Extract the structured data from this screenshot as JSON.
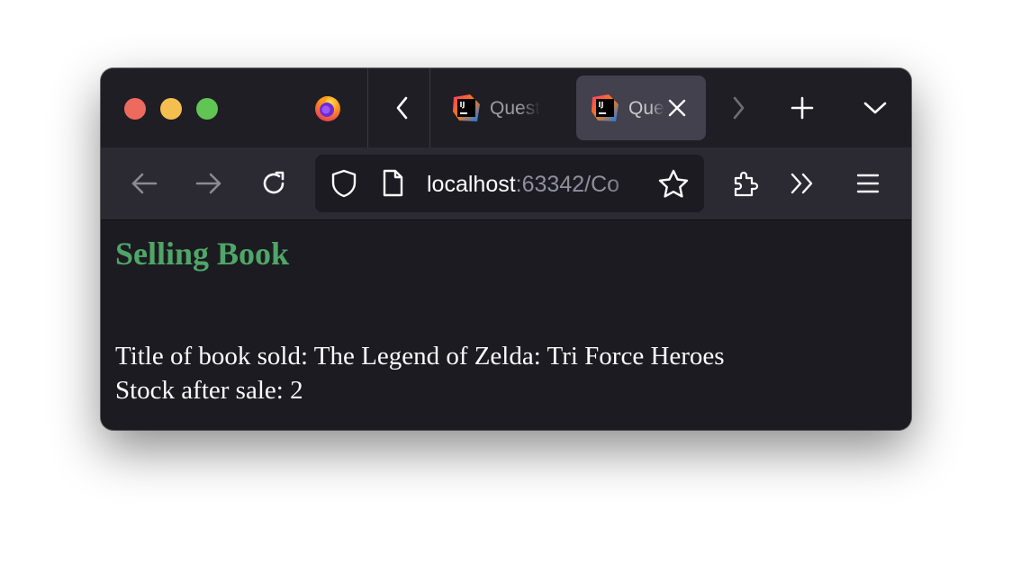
{
  "browser": {
    "tabs": [
      {
        "label": "Questi",
        "active": false,
        "favicon": "intellij-icon"
      },
      {
        "label": "Que",
        "active": true,
        "favicon": "intellij-icon"
      }
    ],
    "url": {
      "host": "localhost",
      "rest": ":63342/Co"
    }
  },
  "page": {
    "heading": "Selling Book",
    "title_line": "Title of book sold: The Legend of Zelda: Tri Force Heroes",
    "stock_line": "Stock after sale: 2"
  },
  "colors": {
    "heading": "#4fa667",
    "chrome_dark": "#1f1e25",
    "toolbar": "#2b2a33",
    "active_tab": "#42414d",
    "page_bg": "#1c1b22"
  }
}
